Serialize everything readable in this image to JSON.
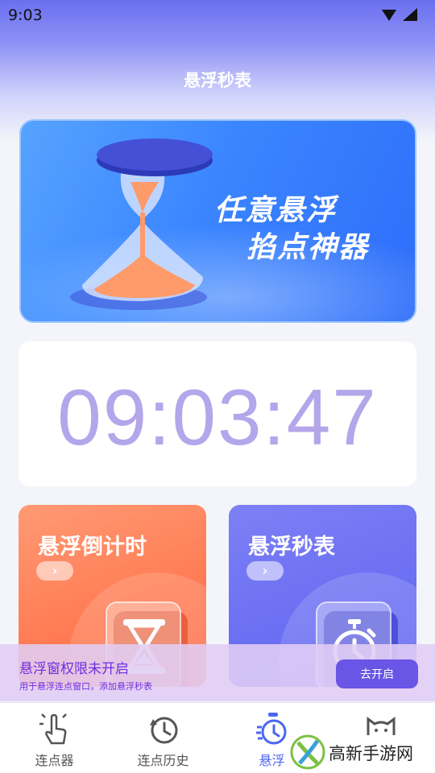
{
  "status_bar": {
    "time": "9:03"
  },
  "header": {
    "title": "悬浮秒表"
  },
  "banner": {
    "line1": "任意悬浮",
    "line2": "掐点神器"
  },
  "clock": {
    "time": "09:03:47"
  },
  "cards": [
    {
      "title": "悬浮倒计时",
      "arrow": "›",
      "icon": "hourglass-icon",
      "color": "#ff7a52"
    },
    {
      "title": "悬浮秒表",
      "arrow": "›",
      "icon": "stopwatch-icon",
      "color": "#6a6ef2"
    }
  ],
  "permission": {
    "title": "悬浮窗权限未开启",
    "subtitle": "用于悬浮连点窗口，添加悬浮秒表",
    "button": "去开启"
  },
  "tabs": [
    {
      "label": "连点器",
      "icon": "tap-hand-icon",
      "active": false
    },
    {
      "label": "连点历史",
      "icon": "history-icon",
      "active": false
    },
    {
      "label": "悬浮",
      "icon": "stopwatch-icon",
      "active": true
    },
    {
      "label": "",
      "icon": "cat-face-icon",
      "active": false
    }
  ],
  "watermark": {
    "text": "高新手游网"
  },
  "colors": {
    "accent": "#4a67ef",
    "clock_digits": "#b3a6ea",
    "permission_text": "#6f2fe0"
  }
}
